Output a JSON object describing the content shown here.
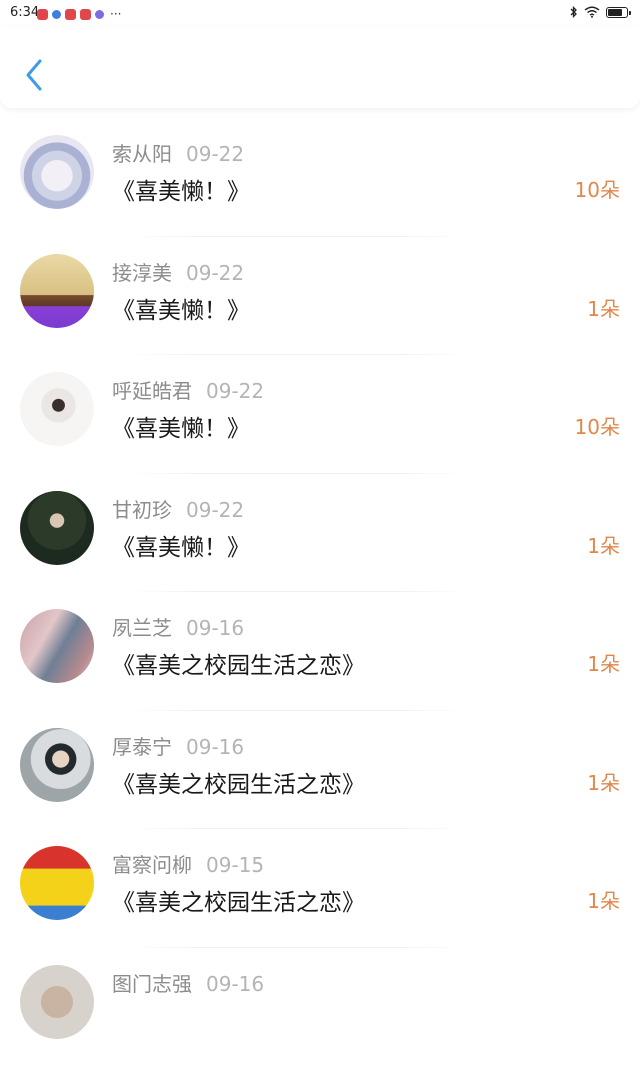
{
  "status_bar": {
    "time": "6:34",
    "more": "···",
    "icons": [
      "app-notification-icon",
      "app-notification-icon",
      "app-notification-icon",
      "app-notification-icon",
      "app-notification-icon",
      "bluetooth-icon",
      "wifi-icon",
      "battery-icon"
    ],
    "battery_level": 0.8
  },
  "header": {
    "back_icon": "chevron-left-icon",
    "accent": "#3d9be9"
  },
  "colors": {
    "count": "#e2874a",
    "name": "#8c8c8c",
    "date": "#b4b4b4",
    "title": "#1a1a1a"
  },
  "items": [
    {
      "name": "索从阳",
      "date": "09-22",
      "title": "《喜美懒！》",
      "count": "10朵"
    },
    {
      "name": "接淳美",
      "date": "09-22",
      "title": "《喜美懒！》",
      "count": "1朵"
    },
    {
      "name": "呼延皓君",
      "date": "09-22",
      "title": "《喜美懒！》",
      "count": "10朵"
    },
    {
      "name": "甘初珍",
      "date": "09-22",
      "title": "《喜美懒！》",
      "count": "1朵"
    },
    {
      "name": "夙兰芝",
      "date": "09-16",
      "title": "《喜美之校园生活之恋》",
      "count": "1朵"
    },
    {
      "name": "厚泰宁",
      "date": "09-16",
      "title": "《喜美之校园生活之恋》",
      "count": "1朵"
    },
    {
      "name": "富察问柳",
      "date": "09-15",
      "title": "《喜美之校园生活之恋》",
      "count": "1朵"
    },
    {
      "name": "图门志强",
      "date": "09-16",
      "title": "",
      "count": ""
    }
  ]
}
